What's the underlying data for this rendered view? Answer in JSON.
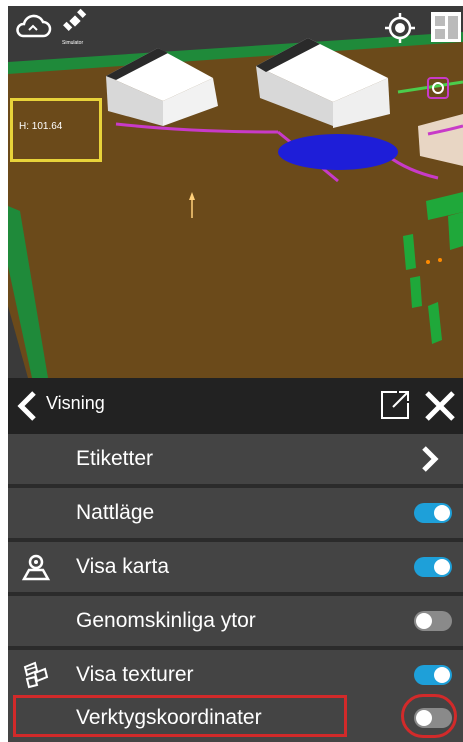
{
  "viewer": {
    "height_readout": "H: 101.64",
    "satellite_label": "Simulator",
    "icons": [
      "cloud-icon",
      "satellite-icon",
      "locate-icon",
      "layout-icon",
      "focus-icon"
    ]
  },
  "panel": {
    "title": "Visning",
    "items": [
      {
        "label": "Etiketter",
        "icon": null,
        "control": "chevron"
      },
      {
        "label": "Nattläge",
        "icon": null,
        "control": "toggle",
        "on": true
      },
      {
        "label": "Visa karta",
        "icon": "map-pin-icon",
        "control": "toggle",
        "on": true
      },
      {
        "label": "Genomskinliga ytor",
        "icon": null,
        "control": "toggle",
        "on": false
      },
      {
        "label": "Visa texturer",
        "icon": "texture-icon",
        "control": "toggle",
        "on": true
      },
      {
        "label": "Verktygskoordinater",
        "icon": null,
        "control": "toggle",
        "on": false
      }
    ]
  },
  "colors": {
    "toggle_on": "#1ea0d9",
    "toggle_off": "#8a8a8a",
    "highlight": "#d22a2a",
    "ground": "#6b4a1a",
    "h_box": "#e8d33a"
  }
}
